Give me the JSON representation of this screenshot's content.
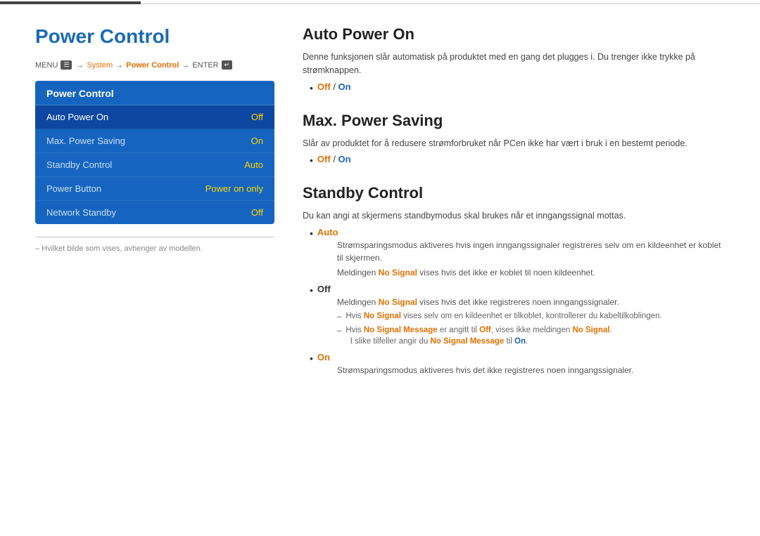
{
  "topbar": {
    "has_dark_bar": true
  },
  "left": {
    "title": "Power Control",
    "breadcrumb": {
      "menu": "MENU",
      "menu_icon": "☰",
      "arrow1": "→",
      "system": "System",
      "arrow2": "→",
      "power_control": "Power Control",
      "arrow3": "→",
      "enter": "ENTER",
      "enter_icon": "↵"
    },
    "menu_box": {
      "header": "Power Control",
      "items": [
        {
          "label": "Auto Power On",
          "value": "Off",
          "active": true
        },
        {
          "label": "Max. Power Saving",
          "value": "On",
          "active": false
        },
        {
          "label": "Standby Control",
          "value": "Auto",
          "active": false
        },
        {
          "label": "Power Button",
          "value": "Power on only",
          "active": false
        },
        {
          "label": "Network Standby",
          "value": "Off",
          "active": false
        }
      ]
    },
    "footnote": "– Hvilket bilde som vises, avhenger av modellen."
  },
  "right": {
    "sections": [
      {
        "id": "auto-power-on",
        "title": "Auto Power On",
        "desc": "Denne funksjonen slår automatisk på produktet med en gang det plugges i. Du trenger ikke trykke på strømknappen.",
        "bullets": [
          {
            "text_before": "",
            "orange": "Off",
            "text_middle": " / ",
            "blue": "On",
            "text_after": ""
          }
        ]
      },
      {
        "id": "max-power-saving",
        "title": "Max. Power Saving",
        "desc": "Slår av produktet for å redusere strømforbruket når PCen ikke har vært i bruk i en bestemt periode.",
        "bullets": [
          {
            "text_before": "",
            "orange": "Off",
            "text_middle": " / ",
            "blue": "On",
            "text_after": ""
          }
        ]
      },
      {
        "id": "standby-control",
        "title": "Standby Control",
        "desc": "Du kan angi at skjermens standbymodus skal brukes når et inngangssignal mottas.",
        "sub_items": [
          {
            "label": "Auto",
            "label_color": "orange",
            "desc": "Strømsparingsmodus aktiveres hvis ingen inngangssignaler registreres selv om en kildeenhet er koblet til skjermen.",
            "sub_lines": [
              "Meldingen No Signal vises hvis det ikke er koblet til noen kildeenhet."
            ]
          },
          {
            "label": "Off",
            "label_color": "normal",
            "desc": "Meldingen No Signal vises hvis det ikke registreres noen inngangssignaler.",
            "dash_lines": [
              {
                "text_before": "Hvis ",
                "bold": "No Signal",
                "bold_color": "orange",
                "text_after": " vises selv om en kildeenhet er tilkoblet, kontrollerer du kabeltilkoblingen."
              },
              {
                "text_before": "Hvis ",
                "bold": "No Signal Message",
                "bold_color": "orange",
                "text_middle": " er angitt til ",
                "bold2": "Off",
                "bold2_color": "orange",
                "text_after": ", vises ikke meldingen ",
                "bold3": "No Signal",
                "bold3_color": "orange",
                "text_last": ".",
                "sub": "I slike tilfeller angir du No Signal Message til On."
              }
            ]
          },
          {
            "label": "On",
            "label_color": "orange",
            "desc": "Strømsparingsmodus aktiveres hvis det ikke registreres noen inngangssignaler.",
            "dash_lines": []
          }
        ]
      }
    ]
  }
}
